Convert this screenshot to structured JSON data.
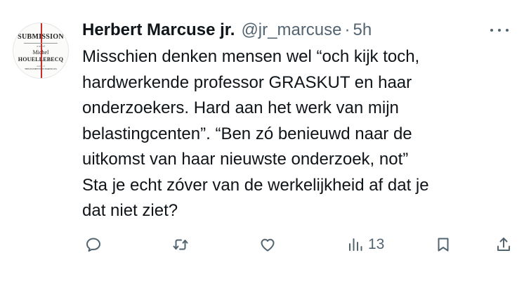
{
  "tweet": {
    "author_name": "Herbert Marcuse jr.",
    "handle": "@jr_marcuse",
    "separator": "·",
    "time": "5h",
    "text_lines": [
      "Misschien denken mensen wel “och kijk toch,",
      "hardwerkende professor GRASKUT en haar",
      "onderzoekers. Hard aan het werk van mijn",
      "belastingcenten”. “Ben zó benieuwd naar de",
      "uitkomst van haar nieuwste onderzoek, not”",
      "Sta je echt zóver van de werkelijkheid af dat je",
      "dat niet ziet?"
    ],
    "views_count": "13"
  },
  "avatar": {
    "cover_title": "SUBMISSION",
    "cover_subtitle": "a novel",
    "cover_author_first": "Michel",
    "cover_author_last": "HOUELLEBECQ",
    "cover_small_1": "Author of",
    "cover_small_2": "THE ELEMENTARY PARTICLES"
  },
  "icons": {
    "more": "more-horizontal-icon",
    "reply": "reply-icon",
    "retweet": "retweet-icon",
    "like": "heart-icon",
    "views": "views-chart-icon",
    "bookmark": "bookmark-icon",
    "share": "share-icon"
  },
  "colors": {
    "text": "#0f1419",
    "secondary": "#536471",
    "background": "#ffffff",
    "avatar_red_line": "#d12a2a"
  }
}
